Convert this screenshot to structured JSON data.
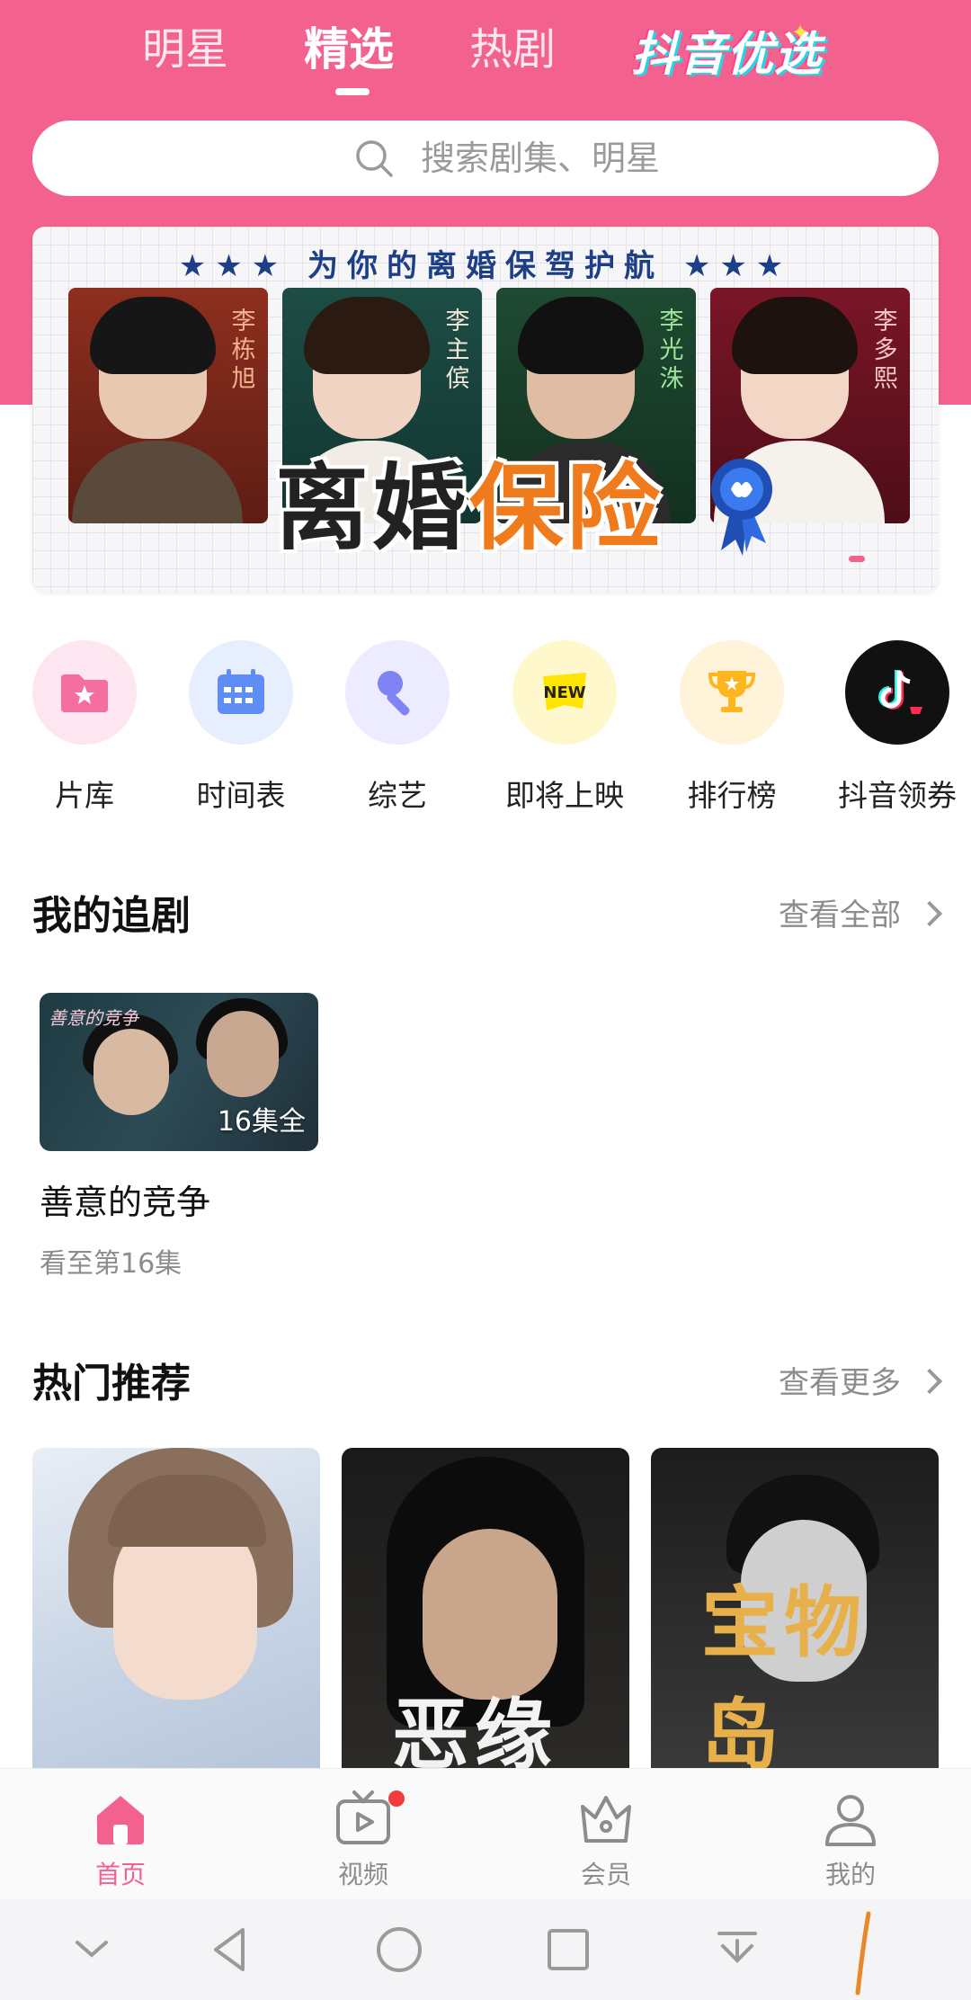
{
  "top_tabs": [
    {
      "label": "明星"
    },
    {
      "label": "精选"
    },
    {
      "label": "热剧"
    }
  ],
  "brand": {
    "label": "抖音优选"
  },
  "search": {
    "placeholder": "搜索剧集、明星"
  },
  "banner": {
    "slogan": "★★★ 为你的离婚保驾护航 ★★★",
    "title_part1": "离婚",
    "title_part2": "保险",
    "cast": [
      "李栋旭",
      "李主傧",
      "李光洙",
      "李多熙"
    ]
  },
  "categories": [
    {
      "label": "片库",
      "icon": "folder-star-icon"
    },
    {
      "label": "时间表",
      "icon": "calendar-icon"
    },
    {
      "label": "综艺",
      "icon": "microphone-icon"
    },
    {
      "label": "即将上映",
      "icon": "new-badge-icon"
    },
    {
      "label": "排行榜",
      "icon": "trophy-icon"
    },
    {
      "label": "抖音领券",
      "icon": "douyin-logo-icon"
    }
  ],
  "my_dramas": {
    "title": "我的追剧",
    "more_label": "查看全部",
    "items": [
      {
        "cover_title": "善意的竞争",
        "episodes": "16集全",
        "name": "善意的竞争",
        "progress": "看至第16集"
      }
    ]
  },
  "hot": {
    "title": "热门推荐",
    "more_label": "查看更多",
    "items": [
      {
        "cover_title": ""
      },
      {
        "cover_title": "恶缘"
      },
      {
        "cover_title": "宝物岛"
      }
    ]
  },
  "bottom_nav": [
    {
      "label": "首页",
      "icon": "home-icon",
      "active": true
    },
    {
      "label": "视频",
      "icon": "tv-play-icon",
      "active": false
    },
    {
      "label": "会员",
      "icon": "crown-icon",
      "active": false
    },
    {
      "label": "我的",
      "icon": "user-icon",
      "active": false
    }
  ],
  "colors": {
    "brand_pink": "#f3628f",
    "navy": "#1d3f86",
    "orange": "#f07b1d"
  }
}
